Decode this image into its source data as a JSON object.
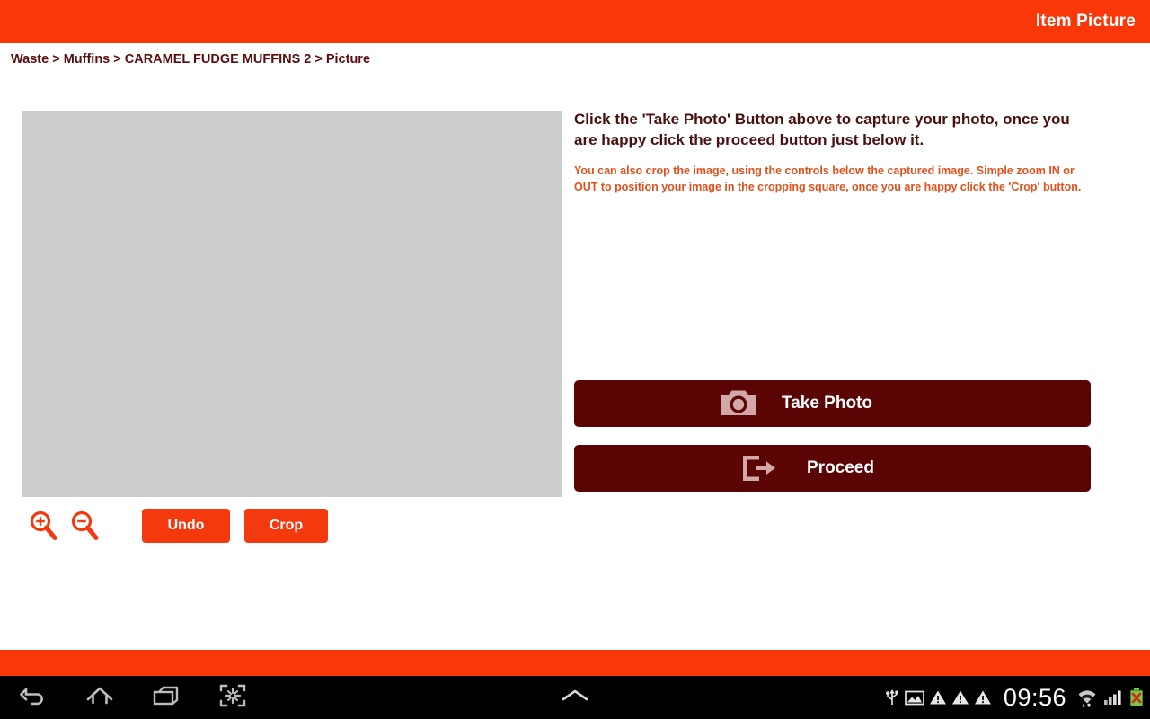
{
  "header": {
    "title": "Item Picture",
    "bg_color": "#fa3708"
  },
  "breadcrumb": {
    "text": "Waste > Muffins > CARAMEL FUDGE MUFFINS 2 > Picture",
    "color": "#5a0d0d"
  },
  "main": {
    "image_preview": {
      "state": "empty",
      "bg_color": "#cccccc"
    },
    "crop_controls": {
      "zoom_in_icon": "zoom-in-icon",
      "zoom_out_icon": "zoom-out-icon",
      "undo_label": "Undo",
      "crop_label": "Crop",
      "button_color": "#f4390f"
    },
    "instructions": {
      "primary": "Click the 'Take Photo' Button above to capture your photo, once you are happy click the proceed button just below it.",
      "primary_color": "#4a1010",
      "secondary": "You can also crop the image, using the controls below the captured image. Simple zoom IN or OUT to position your image in the cropping square, once you are happy click the 'Crop' button.",
      "secondary_color": "#e2501c"
    },
    "actions": {
      "button_color": "#5a0404",
      "take_photo": {
        "label": "Take Photo",
        "icon": "camera-icon"
      },
      "proceed": {
        "label": "Proceed",
        "icon": "exit-arrow-icon"
      }
    }
  },
  "system_navbar": {
    "bg_color": "#000000",
    "buttons": [
      {
        "name": "back",
        "icon": "back-arrow-icon"
      },
      {
        "name": "home",
        "icon": "home-icon"
      },
      {
        "name": "recents",
        "icon": "recent-apps-icon"
      },
      {
        "name": "screenshot",
        "icon": "screenshot-icon"
      }
    ],
    "center_handle_icon": "chevron-up-icon",
    "status": {
      "time": "09:56",
      "icons": [
        "usb-icon",
        "gallery-icon",
        "warning-triangle-icon",
        "warning-triangle-icon",
        "warning-triangle-icon",
        "wifi-icon",
        "cellular-signal-icon",
        "battery-error-icon"
      ]
    }
  }
}
